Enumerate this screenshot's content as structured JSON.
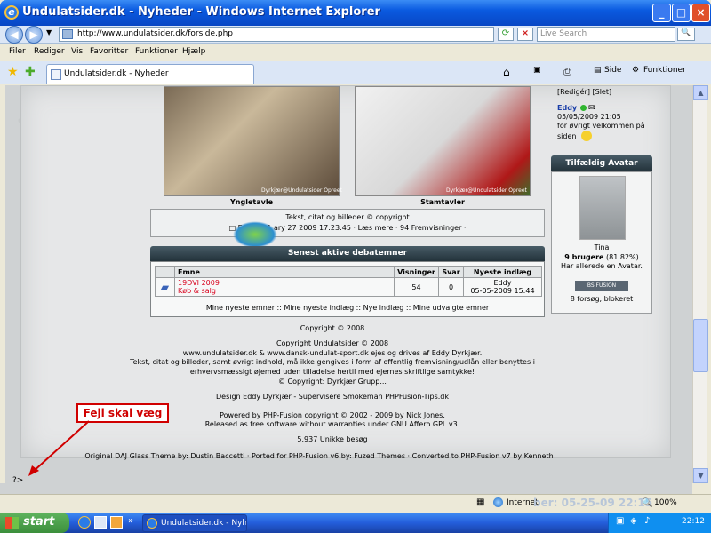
{
  "window": {
    "title": "Undulatsider.dk - Nyheder - Windows Internet Explorer",
    "min": "_",
    "max": "□",
    "close": "×"
  },
  "address": {
    "url": "http://www.undulatsider.dk/forside.php",
    "search_placeholder": "Live Search"
  },
  "menu": {
    "items": [
      "Filer",
      "Rediger",
      "Vis",
      "Favoritter",
      "Funktioner",
      "Hjælp"
    ]
  },
  "tab": {
    "label": "Undulatsider.dk - Nyheder"
  },
  "toolbar": {
    "side": "Side",
    "funktioner": "Funktioner"
  },
  "gallery": {
    "left_caption": "Yngletavle",
    "right_caption": "Stamtavler",
    "watermark_left": "Dyrkjær@Undulatsider Opreet",
    "watermark_right": "Dyrkjær@Undulatsider Opreet"
  },
  "news": {
    "line1": "Tekst, citat og billeder © copyright",
    "line2": "□ Eddy d. 1    ary 27 2009 17:23:45 · Læs mere · 94 Fremvisninger ·"
  },
  "debate": {
    "title": "Senest aktive debatemner",
    "headers": [
      "Emne",
      "Visninger",
      "Svar",
      "Nyeste indlæg"
    ],
    "row": {
      "topic": "19DVI 2009",
      "sub": "Køb & salg",
      "views": "54",
      "replies": "0",
      "last_user": "Eddy",
      "last_date": "05-05-2009 15:44"
    },
    "links": "Mine nyeste emner :: Mine nyeste indlæg :: Nye indlæg :: Mine udvalgte emner"
  },
  "footer": {
    "l1": "Copyright © 2008",
    "l2": "Copyright Undulatsider © 2008",
    "l3": "www.undulatsider.dk & www.dansk-undulat-sport.dk ejes og drives af Eddy Dyrkjær.",
    "l4": "Tekst, citat og billeder, samt øvrigt indhold, må ikke gengives i form af offentlig fremvisning/udlån eller benyttes i",
    "l5": "erhvervsmæssigt øjemed uden tilladelse hertil med ejernes skriftlige samtykke!",
    "l6": "© Copyright: Dyrkjær Grupp...",
    "l7": "Design Eddy Dyrkjær - Supervisere Smokeman PHPFusion-Tips.dk",
    "l8": "Powered by PHP-Fusion copyright © 2002 - 2009 by Nick Jones.",
    "l9": "Released as free software without warranties under GNU Affero GPL v3.",
    "l10": "5.937 Unikke besøg",
    "l11": "Original DAJ Glass Theme by: Dustin Baccetti · Ported for PHP-Fusion v6 by: Fuzed Themes · Converted to PHP-Fusion v7 by Kenneth"
  },
  "sidebar": {
    "edit_links": "[Redigér] [Slet]",
    "user": "Eddy",
    "date": "05/05/2009 21:05",
    "msg1": "for øvrigt velkommen på",
    "msg2": "siden",
    "avatar_title": "Tilfældig Avatar",
    "avatar_name": "Tina",
    "users_count": "9 brugere",
    "users_pct": "(81.82%)",
    "users_text": "Har allerede en Avatar.",
    "fusion_label": "BS FUSION",
    "fusion_sub": "8 forsøg, blokeret"
  },
  "annotation": {
    "label": "Fejl skal væg"
  },
  "bottom_sig": "?>",
  "status": {
    "zone": "Internet",
    "zoom": "100%",
    "faded": "ber: 05-25-09 22:15"
  },
  "taskbar": {
    "start": "start",
    "task": "Undulatsider.dk - Nyh...",
    "time": "22:12"
  }
}
